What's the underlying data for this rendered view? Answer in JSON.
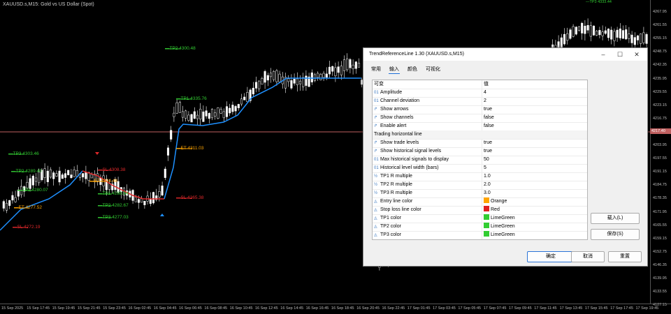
{
  "chart": {
    "title": "XAUUSD.s,M15: Gold vs US Dollar (Spot)",
    "y_ticks": [
      "4267.95",
      "4261.55",
      "4255.15",
      "4248.75",
      "4242.35",
      "4235.95",
      "4229.55",
      "4223.15",
      "4216.75",
      "4210.35",
      "4203.95",
      "4197.55",
      "4191.15",
      "4184.75",
      "4178.35",
      "4171.95",
      "4165.55",
      "4159.15",
      "4152.75",
      "4146.35",
      "4139.95",
      "4133.55",
      "4127.15"
    ],
    "price_tag": "4217.40",
    "x_ticks": [
      "15 Sep 2025",
      "15 Sep 17:45",
      "15 Sep 19:45",
      "15 Sep 21:45",
      "15 Sep 23:45",
      "16 Sep 02:45",
      "16 Sep 04:45",
      "16 Sep 06:45",
      "16 Sep 08:45",
      "16 Sep 10:45",
      "16 Sep 12:45",
      "16 Sep 14:45",
      "16 Sep 16:45",
      "16 Sep 18:45",
      "16 Sep 20:45",
      "16 Sep 22:45",
      "17 Sep 01:45",
      "17 Sep 03:45",
      "17 Sep 05:45",
      "17 Sep 07:45",
      "17 Sep 09:45",
      "17 Sep 11:45",
      "17 Sep 13:45",
      "17 Sep 15:45",
      "17 Sep 17:45",
      "17 Sep 19:45"
    ],
    "levels": {
      "tp2_a": "TP2 4300.48",
      "tp1_a": "TP1 4335.76",
      "et_a": "ET 4311.03",
      "sl_a": "SL 4265.38",
      "tp3_b": "TP3 4303.46",
      "tp2_b": "TP2 4289.40",
      "tp1_b": "TP1 4280.07",
      "et_b": "ET 4277.52",
      "sl_b": "SL 4272.19",
      "sl_c": "SL 4308.38",
      "et_c": "ET 4304.48",
      "tp1_c": "TP1 4288.64",
      "tp2_c": "TP2 4282.67",
      "tp3_c": "TP3 4277.03",
      "top_right": "TP3 4333.44"
    },
    "colors": {
      "up": "#ffffff",
      "trend": "#1e90ff",
      "trend_down": "#e0282a",
      "hline": "#c06060"
    }
  },
  "dialog": {
    "title": "TrendReferenceLine 1.30 (XAUUSD.s,M15)",
    "tabs": [
      "常用",
      "输入",
      "颜色",
      "可视化"
    ],
    "active_tab": 1,
    "header": {
      "name": "可变",
      "value": "值"
    },
    "rows": [
      {
        "type": "param",
        "pfx": "01",
        "name": "Amplitude",
        "value": "4"
      },
      {
        "type": "param",
        "pfx": "01",
        "name": "Channel deviation",
        "value": "2"
      },
      {
        "type": "param",
        "pfx": "↱",
        "name": "Show arrows",
        "value": "true"
      },
      {
        "type": "param",
        "pfx": "↱",
        "name": "Show channels",
        "value": "false"
      },
      {
        "type": "param",
        "pfx": "↱",
        "name": "Enable alert",
        "value": "false"
      },
      {
        "type": "section",
        "name": "Trading horizontal line"
      },
      {
        "type": "param",
        "pfx": "↱",
        "name": "Show trade levels",
        "value": "true"
      },
      {
        "type": "param",
        "pfx": "↱",
        "name": "Show historical signal levels",
        "value": "true"
      },
      {
        "type": "param",
        "pfx": "01",
        "name": "Max historical signals to display",
        "value": "50"
      },
      {
        "type": "param",
        "pfx": "01",
        "name": "Historical level width (bars)",
        "value": "5"
      },
      {
        "type": "param",
        "pfx": "½",
        "name": "TP1 R multiple",
        "value": "1.0"
      },
      {
        "type": "param",
        "pfx": "½",
        "name": "TP2 R multiple",
        "value": "2.0"
      },
      {
        "type": "param",
        "pfx": "½",
        "name": "TP3 R multiple",
        "value": "3.0"
      },
      {
        "type": "color",
        "pfx": "◬",
        "name": "Entry line color",
        "value": "Orange",
        "color": "#ffa500"
      },
      {
        "type": "color",
        "pfx": "◬",
        "name": "Stop loss line color",
        "value": "Red",
        "color": "#e02020"
      },
      {
        "type": "color",
        "pfx": "◬",
        "name": "TP1 color",
        "value": "LimeGreen",
        "color": "#32cd32"
      },
      {
        "type": "color",
        "pfx": "◬",
        "name": "TP2 color",
        "value": "LimeGreen",
        "color": "#32cd32"
      },
      {
        "type": "color",
        "pfx": "◬",
        "name": "TP3 color",
        "value": "LimeGreen",
        "color": "#32cd32"
      }
    ],
    "buttons": {
      "load": "载入(L)",
      "save": "保存(S)",
      "ok": "确定",
      "cancel": "取消",
      "reset": "重置"
    }
  }
}
